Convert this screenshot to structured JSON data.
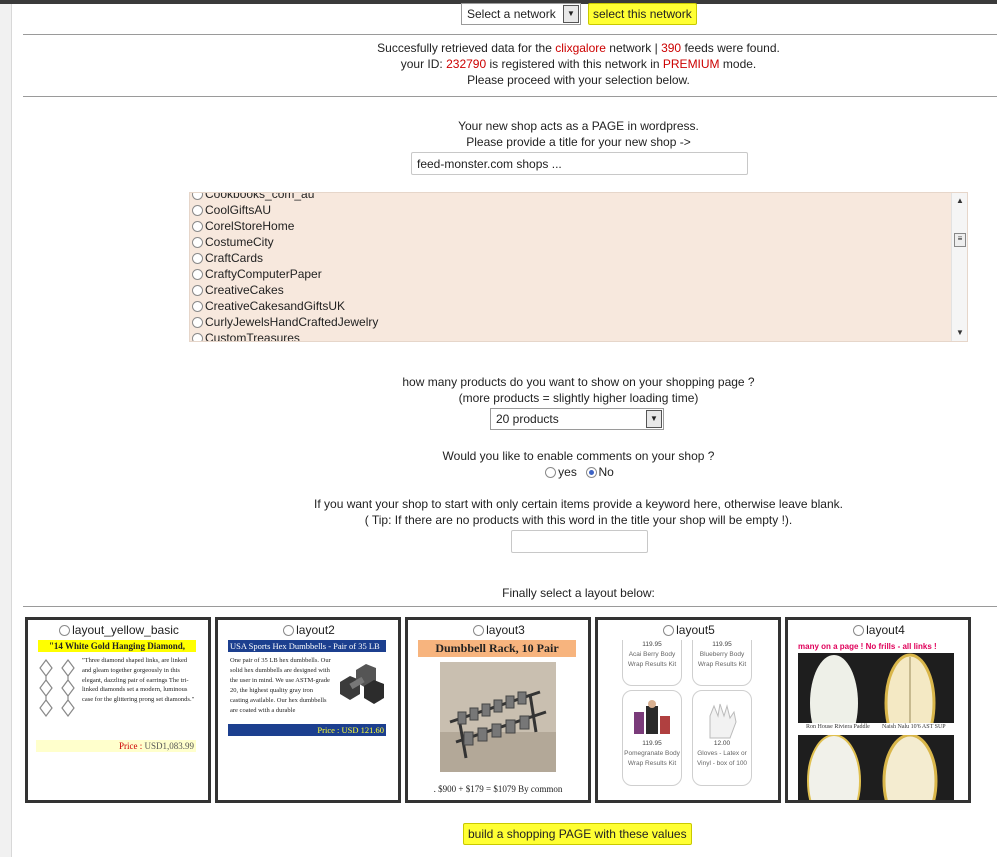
{
  "network_bar": {
    "select_value": "Select a network",
    "button_label": "select this network"
  },
  "status": {
    "l1_pre": "Succesfully retrieved data for the ",
    "network_name": "clixgalore",
    "l1_mid": " network | ",
    "feed_count": "390",
    "l1_post": " feeds were found.",
    "l2_pre": "your ID: ",
    "user_id": "232790",
    "l2_mid": " is registered with this network in ",
    "mode": "PREMIUM",
    "l2_post": " mode.",
    "l3": "Please proceed with your selection below."
  },
  "page_title": {
    "line1": "Your new shop acts as a PAGE in wordpress.",
    "line2": "Please provide a title for your new shop ->",
    "value": "feed-monster.com shops ..."
  },
  "shops": [
    "Cookbooks_com_au",
    "CoolGiftsAU",
    "CorelStoreHome",
    "CostumeCity",
    "CraftCards",
    "CraftyComputerPaper",
    "CreativeCakes",
    "CreativeCakesandGiftsUK",
    "CurlyJewelsHandCraftedJewelry",
    "CustomTreasures"
  ],
  "products": {
    "line1": "how many products do you want to show on your shopping page ?",
    "line2": "(more products = slightly higher loading time)",
    "select_value": "20 products"
  },
  "comments": {
    "question": "Would you like to enable comments on your shop ?",
    "yes_label": "yes",
    "no_label": "No"
  },
  "keyword": {
    "line1": "If you want your shop to start with only certain items provide a keyword here, otherwise leave blank.",
    "line2": "( Tip: If there are no products with this word in the title your shop will be empty !).",
    "value": ""
  },
  "layout_prompt": "Finally select a layout below:",
  "layouts": [
    {
      "label": "layout_yellow_basic",
      "title": "\"14 White Gold Hanging Diamond,",
      "text": "\"Three diamond shaped links, are linked and gleam together gorgeously in this elegant, dazzling pair of earrings The tri-linked diamonds set a modern, luminous case for the glittering prong set diamonds.\"",
      "price_label": "Price :",
      "price_value": "USD1,083.99"
    },
    {
      "label": "layout2",
      "title": "USA Sports Hex Dumbbells - Pair of 35 LB",
      "text": "One pair of 35 LB hex dumbbells. Our solid hex dumbbells are designed with the user in mind. We use ASTM-grade 20, the highest quality gray iron casting available. Our hex dumbbells are coated with a durable",
      "price": "Price : USD 121.60"
    },
    {
      "label": "layout3",
      "title": "Dumbbell Rack, 10 Pair",
      "price_line": ". $900 + $179 = $1079 By common"
    },
    {
      "label": "layout5",
      "cells": [
        {
          "price": "119.95",
          "name": "Acai Berry Body Wrap Results Kit"
        },
        {
          "price": "119.95",
          "name": "Blueberry Body Wrap Results Kit"
        },
        {
          "price": "119.95",
          "name": "Pomegranate Body Wrap Results Kit"
        },
        {
          "price": "12.00",
          "name": "Gloves - Latex or Vinyl - box of 100"
        }
      ]
    },
    {
      "label": "layout4",
      "note": "many on a page ! No frills - all links !",
      "cap1": "Ron House Riviera Paddle",
      "cap2": "Naish Nalu 10'6 AST SUP"
    }
  ],
  "build_button": "build a shopping PAGE with these values",
  "colors": {
    "accent_red": "#cc0000",
    "button_yellow": "#ffff33",
    "list_bg": "#f7e8dd"
  }
}
